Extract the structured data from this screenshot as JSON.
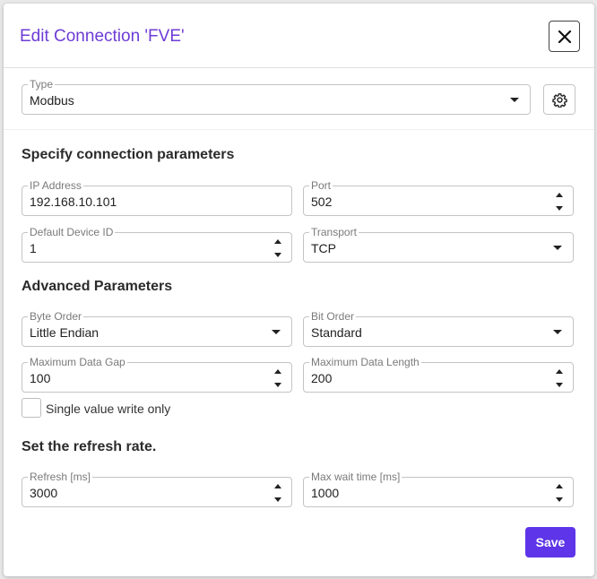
{
  "dialog": {
    "title": "Edit Connection 'FVE'"
  },
  "type_field": {
    "label": "Type",
    "value": "Modbus"
  },
  "connection": {
    "heading": "Specify connection parameters",
    "ip_address": {
      "label": "IP Address",
      "value": "192.168.10.101"
    },
    "port": {
      "label": "Port",
      "value": "502"
    },
    "default_device_id": {
      "label": "Default Device ID",
      "value": "1"
    },
    "transport": {
      "label": "Transport",
      "value": "TCP"
    }
  },
  "advanced": {
    "heading": "Advanced Parameters",
    "byte_order": {
      "label": "Byte Order",
      "value": "Little Endian"
    },
    "bit_order": {
      "label": "Bit Order",
      "value": "Standard"
    },
    "max_data_gap": {
      "label": "Maximum Data Gap",
      "value": "100"
    },
    "max_data_length": {
      "label": "Maximum Data Length",
      "value": "200"
    },
    "single_write": {
      "label": "Single value write only",
      "checked": false
    }
  },
  "refresh": {
    "heading": "Set the refresh rate.",
    "refresh_ms": {
      "label": "Refresh [ms]",
      "value": "3000"
    },
    "max_wait_ms": {
      "label": "Max wait time [ms]",
      "value": "1000"
    }
  },
  "actions": {
    "save_label": "Save"
  },
  "colors": {
    "title": "#6d3cd6",
    "save_button": "#5e35e8"
  },
  "icons": {
    "close": "close-icon",
    "settings": "gear-icon",
    "dropdown": "chevron-down-icon",
    "spinner": "spinner-arrows-icon"
  }
}
